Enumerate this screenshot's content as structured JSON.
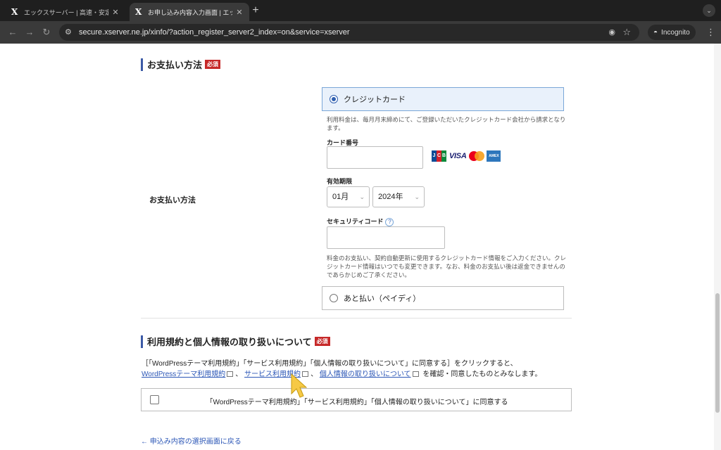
{
  "browser": {
    "tabs": [
      {
        "title": "エックスサーバー | 高速・安定性",
        "favicon": "X"
      },
      {
        "title": "お申し込み内容入力画面 | エックス",
        "favicon": "X"
      }
    ],
    "new_tab": "+",
    "url": "secure.xserver.ne.jp/xinfo/?action_register_server2_index=on&service=xserver",
    "incognito_label": "Incognito"
  },
  "payment": {
    "heading": "お支払い方法",
    "required_badge": "必須",
    "row_label": "お支払い方法",
    "credit_card": {
      "label": "クレジットカード",
      "selected": true,
      "note": "利用料金は、毎月月末締めにて、ご登録いただいたクレジットカード会社から請求となります。",
      "card_number_label": "カード番号",
      "card_number_value": "",
      "card_brands": [
        "JCB",
        "VISA",
        "Mastercard",
        "AMEX"
      ],
      "expiry_label": "有効期限",
      "expiry_month": "01月",
      "expiry_year": "2024年",
      "security_code_label": "セキュリティコード",
      "security_code_value": "",
      "footer_note": "料金のお支払い、契約自動更新に使用するクレジットカード情報をご入力ください。クレジットカード情報はいつでも変更できます。なお、料金のお支払い後は返金できませんのであらかじめご了承ください。"
    },
    "deferred": {
      "label": "あと払い（ペイディ）",
      "selected": false
    }
  },
  "terms": {
    "heading": "利用規約と個人情報の取り扱いについて",
    "required_badge": "必須",
    "intro": "［「WordPressテーマ利用規約」「サービス利用規約」「個人情報の取り扱いについて」に同意する］をクリックすると、",
    "link_wordpress": "WordPressテーマ利用規約",
    "link_service": "サービス利用規約",
    "link_privacy": "個人情報の取り扱いについて",
    "separator": "、",
    "outro": "を確認・同意したものとみなします。",
    "agree_label": "「WordPressテーマ利用規約」「サービス利用規約」「個人情報の取り扱いについて」に同意する",
    "agree_checked": false
  },
  "back_link": "← 申込み内容の選択画面に戻る",
  "colors": {
    "accent": "#3c5aa6",
    "required": "#c62828",
    "link": "#2b56b6",
    "cursor": "#f6c945"
  }
}
